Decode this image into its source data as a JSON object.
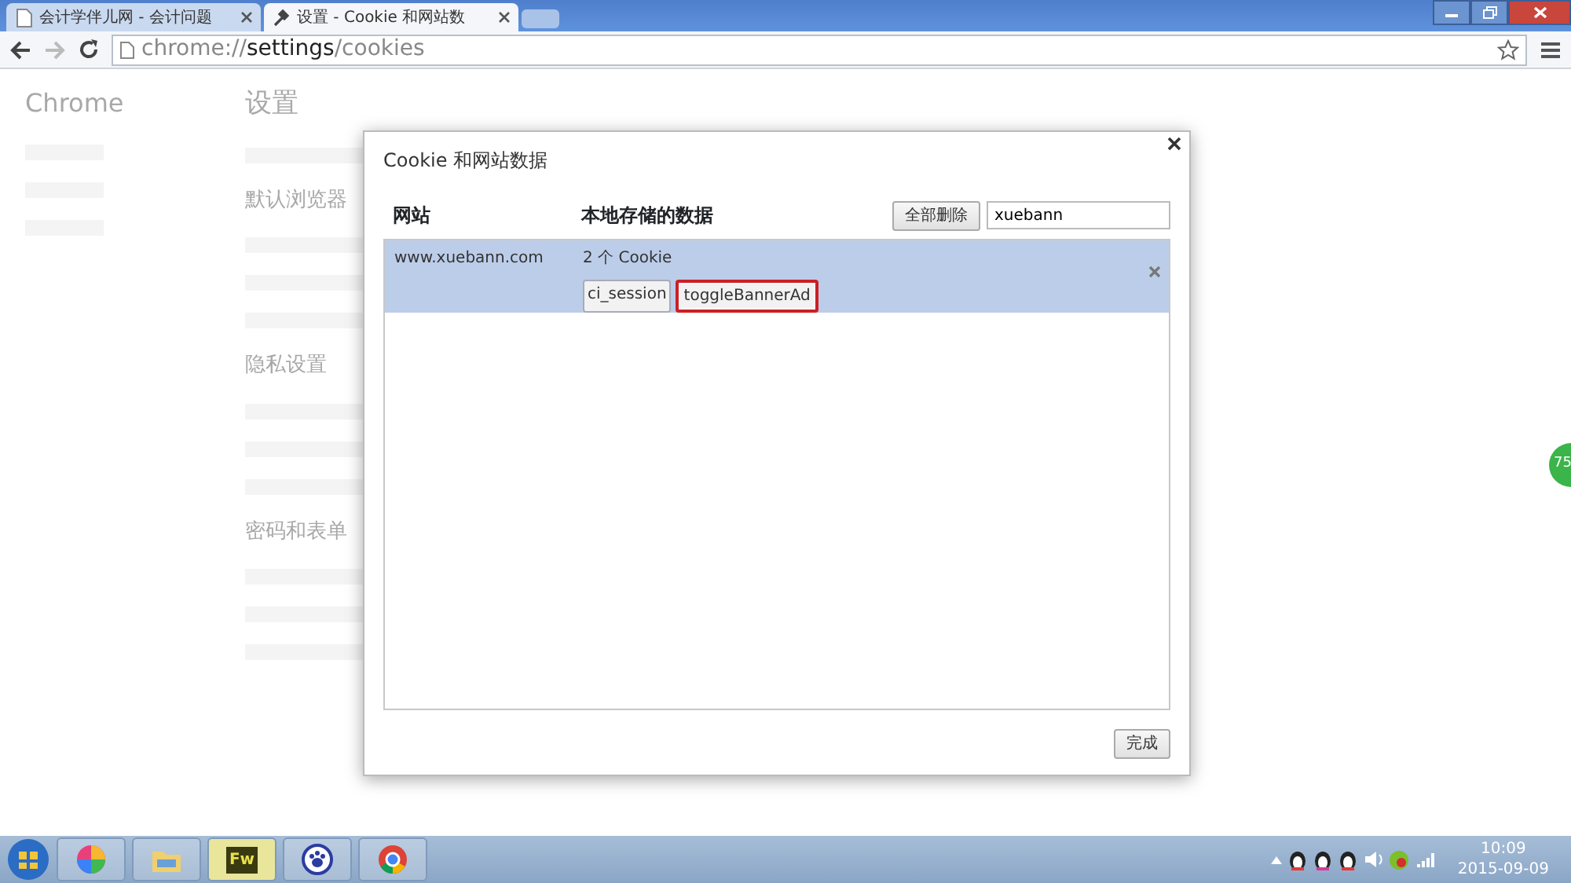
{
  "tabs": [
    {
      "title": "会计学伴儿网 - 会计问题",
      "selected": false,
      "kind": "page"
    },
    {
      "title": "设置 - Cookie 和网站数",
      "selected": true,
      "kind": "settings"
    }
  ],
  "address": {
    "scheme": "chrome://",
    "host": "settings",
    "path": "/cookies"
  },
  "background": {
    "brand": "Chrome",
    "heading": "设置",
    "sections": [
      "默认浏览器",
      "隐私设置",
      "密码和表单"
    ]
  },
  "dialog": {
    "title": "Cookie 和网站数据",
    "columns": [
      "网站",
      "本地存储的数据"
    ],
    "remove_all": "全部删除",
    "search": {
      "value": "xuebann"
    },
    "sites": [
      {
        "site": "www.xuebann.com",
        "summary": "2 个 Cookie",
        "selected": true,
        "cookies": [
          {
            "name": "ci_session",
            "highlighted": false
          },
          {
            "name": "toggleBannerAd",
            "highlighted": true
          }
        ]
      }
    ],
    "done": "完成"
  },
  "side_widget": {
    "text": "75"
  },
  "taskbar": {
    "apps": [
      {
        "kind": "pinwheel",
        "selected": false
      },
      {
        "kind": "folder",
        "selected": false
      },
      {
        "kind": "fw",
        "label": "Fw",
        "selected": true
      },
      {
        "kind": "paw",
        "selected": false
      },
      {
        "kind": "chrome",
        "selected": false
      }
    ],
    "time": "10:09",
    "date": "2015-09-09"
  }
}
